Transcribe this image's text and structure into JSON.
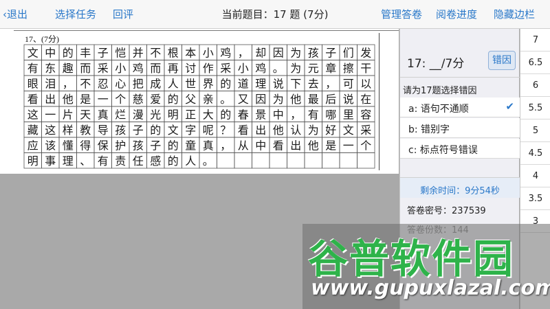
{
  "topbar": {
    "back_label": "‹退出",
    "select_task_label": "选择任务",
    "review_label": "回评",
    "title": "当前题目：17 题 (7分)",
    "manage_label": "管理答卷",
    "progress_label": "阅卷进度",
    "hide_sidebar_label": "隐藏边栏"
  },
  "sheet": {
    "question_label": "17、(7分)",
    "handwriting": [
      "文中的丰子恺并不根本小鸡，却因为孩子们发",
      "有东趣而采小鸡而再讨作采小鸡。为元章擦干",
      "眼泪，不忍心把成人世界的道理说下去，可以",
      "看出他是一个慈爱的父亲。又因为他最后说在",
      "这一片天真烂漫光明正大的春景中，有哪里容",
      "藏这样教导孩子的文字呢？看出他认为好文采",
      "应该懂得保护孩子的童真，从中看出他是一个",
      "明事理、有责任感的人。"
    ]
  },
  "panel": {
    "score_label": "17: __/7分",
    "reason_button": "错因",
    "prompt": "请为17题选择错因",
    "options": [
      {
        "label": "a: 语句不通顺",
        "selected": true
      },
      {
        "label": "b: 错别字",
        "selected": false
      },
      {
        "label": "c: 标点符号错误",
        "selected": false
      }
    ],
    "timer": "剩余时间：9分54秒",
    "secret_label": "答卷密号：237539",
    "count_label": "答卷份数：144"
  },
  "score_options": [
    "7",
    "6.5",
    "6",
    "5.5",
    "5",
    "4.5",
    "4",
    "3.5",
    "3"
  ],
  "watermark": {
    "name": "谷普软件园",
    "url": "www.gupuxlazal.com"
  },
  "colors": {
    "accent": "#2a78c9",
    "watermark_green": "#2eb34a"
  },
  "icons": {
    "check": "checkmark-icon"
  }
}
